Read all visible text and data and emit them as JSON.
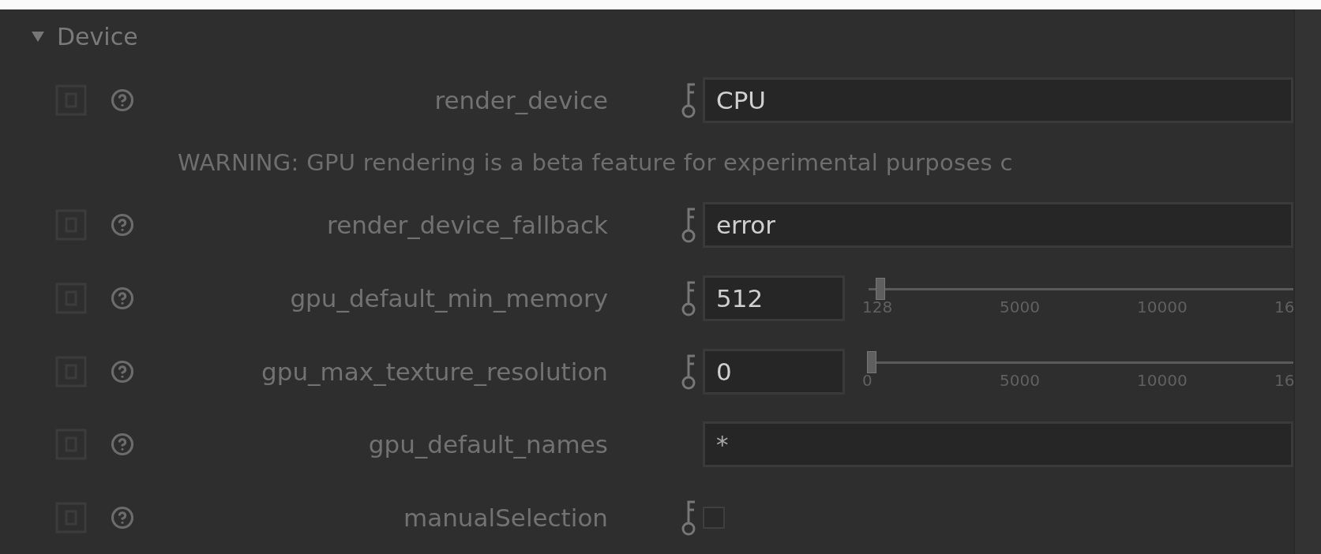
{
  "section": {
    "title": "Device",
    "expanded": true
  },
  "rows": [
    {
      "kind": "enum",
      "label": "render_device",
      "key_icon": true,
      "value": "CPU"
    },
    {
      "kind": "note",
      "text": "WARNING: GPU rendering is a beta feature for experimental purposes c"
    },
    {
      "kind": "enum",
      "label": "render_device_fallback",
      "key_icon": true,
      "value": "error"
    },
    {
      "kind": "slider",
      "label": "gpu_default_min_memory",
      "key_icon": true,
      "value": "512",
      "level": 0.02,
      "ticks": [
        "128",
        "5000",
        "10000",
        "16"
      ]
    },
    {
      "kind": "slider",
      "label": "gpu_max_texture_resolution",
      "key_icon": true,
      "value": "0",
      "level": 0,
      "ticks": [
        "0",
        "5000",
        "10000",
        "16"
      ]
    },
    {
      "kind": "text",
      "label": "gpu_default_names",
      "key_icon": false,
      "value": "*"
    },
    {
      "kind": "checkbox",
      "label": "manualSelection",
      "key_icon": true,
      "checked": false
    }
  ]
}
